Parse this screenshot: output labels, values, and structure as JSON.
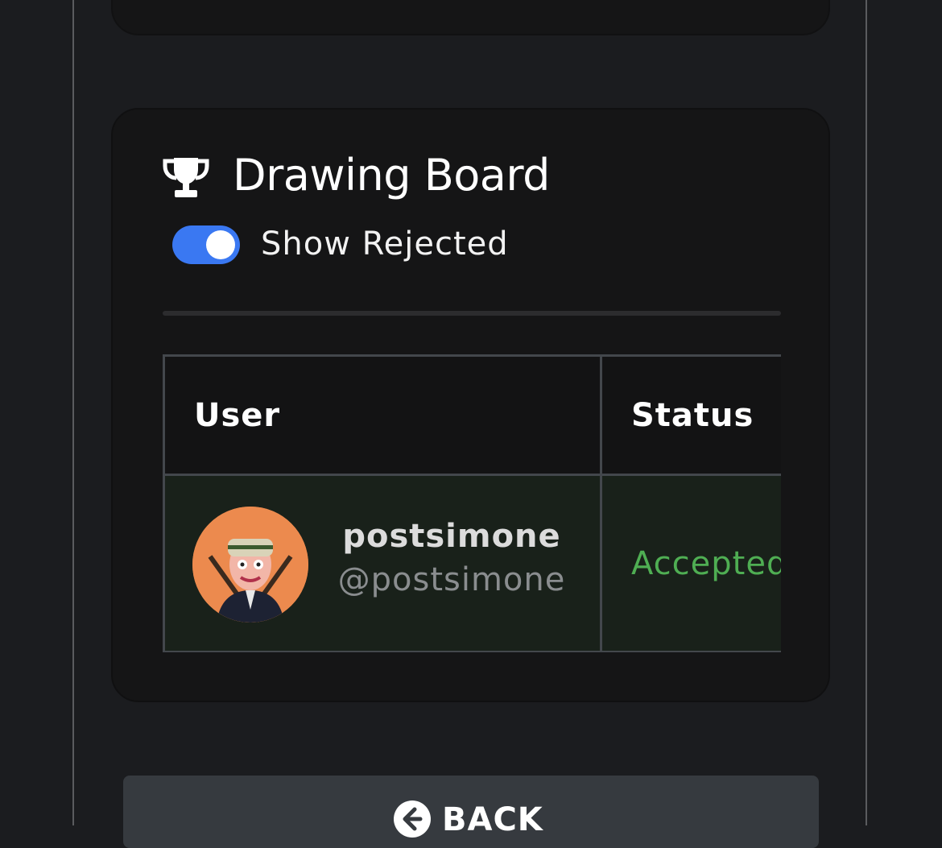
{
  "board": {
    "title": "Drawing Board",
    "icon": "trophy-icon",
    "show_rejected": {
      "label": "Show Rejected",
      "enabled": true
    }
  },
  "table": {
    "columns": [
      "User",
      "Status"
    ],
    "rows": [
      {
        "name": "postsimone",
        "handle": "@postsimone",
        "status": "Accepted"
      }
    ]
  },
  "footer": {
    "back_label": "BACK",
    "back_icon": "arrow-left-circle-icon"
  },
  "colors": {
    "accent": "#3a78f2",
    "accepted": "#4fae53",
    "accepted_row_bg": "#19211a"
  }
}
